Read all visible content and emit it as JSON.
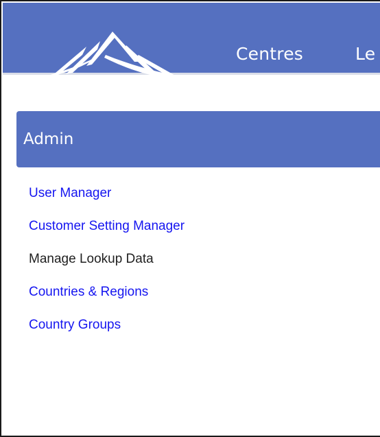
{
  "nav": {
    "items": [
      {
        "label": "Centres"
      },
      {
        "label": "Le"
      }
    ]
  },
  "panel": {
    "title": "Admin"
  },
  "menu": {
    "items": [
      {
        "label": "User Manager",
        "link": true
      },
      {
        "label": "Customer Setting Manager",
        "link": true
      },
      {
        "label": "Manage Lookup Data",
        "link": false
      },
      {
        "label": "Countries & Regions",
        "link": true
      },
      {
        "label": "Country Groups",
        "link": true
      }
    ]
  },
  "colors": {
    "header_bg": "#5570c0",
    "link": "#1515f0",
    "text": "#1f1f1f"
  },
  "icons": {
    "logo": "mountain-logo-icon"
  }
}
